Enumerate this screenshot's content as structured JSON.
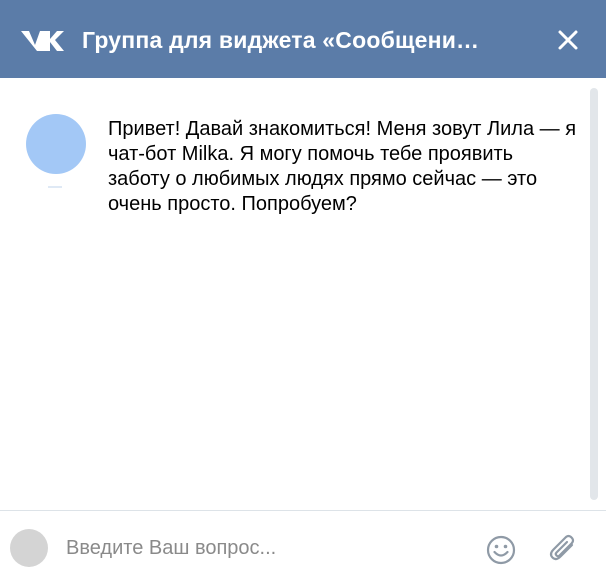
{
  "header": {
    "title": "Группа для виджета «Сообщени…",
    "logo_icon": "vk-logo-icon",
    "close_icon": "close-icon",
    "background_color": "#5b7ca8"
  },
  "conversation": {
    "bot_avatar_color": "#a3c8f6",
    "bot_message": "Привет! Давай знакомиться! Меня зовут Лила — я чат-бот Milka. Я могу помочь тебе проявить заботу о любимых людях прямо сейчас — это очень просто. Попробуем?"
  },
  "composer": {
    "placeholder": "Введите Ваш вопрос...",
    "value": "",
    "emoji_icon": "emoji-icon",
    "attach_icon": "paperclip-icon",
    "user_avatar_color": "#d4d4d4"
  }
}
